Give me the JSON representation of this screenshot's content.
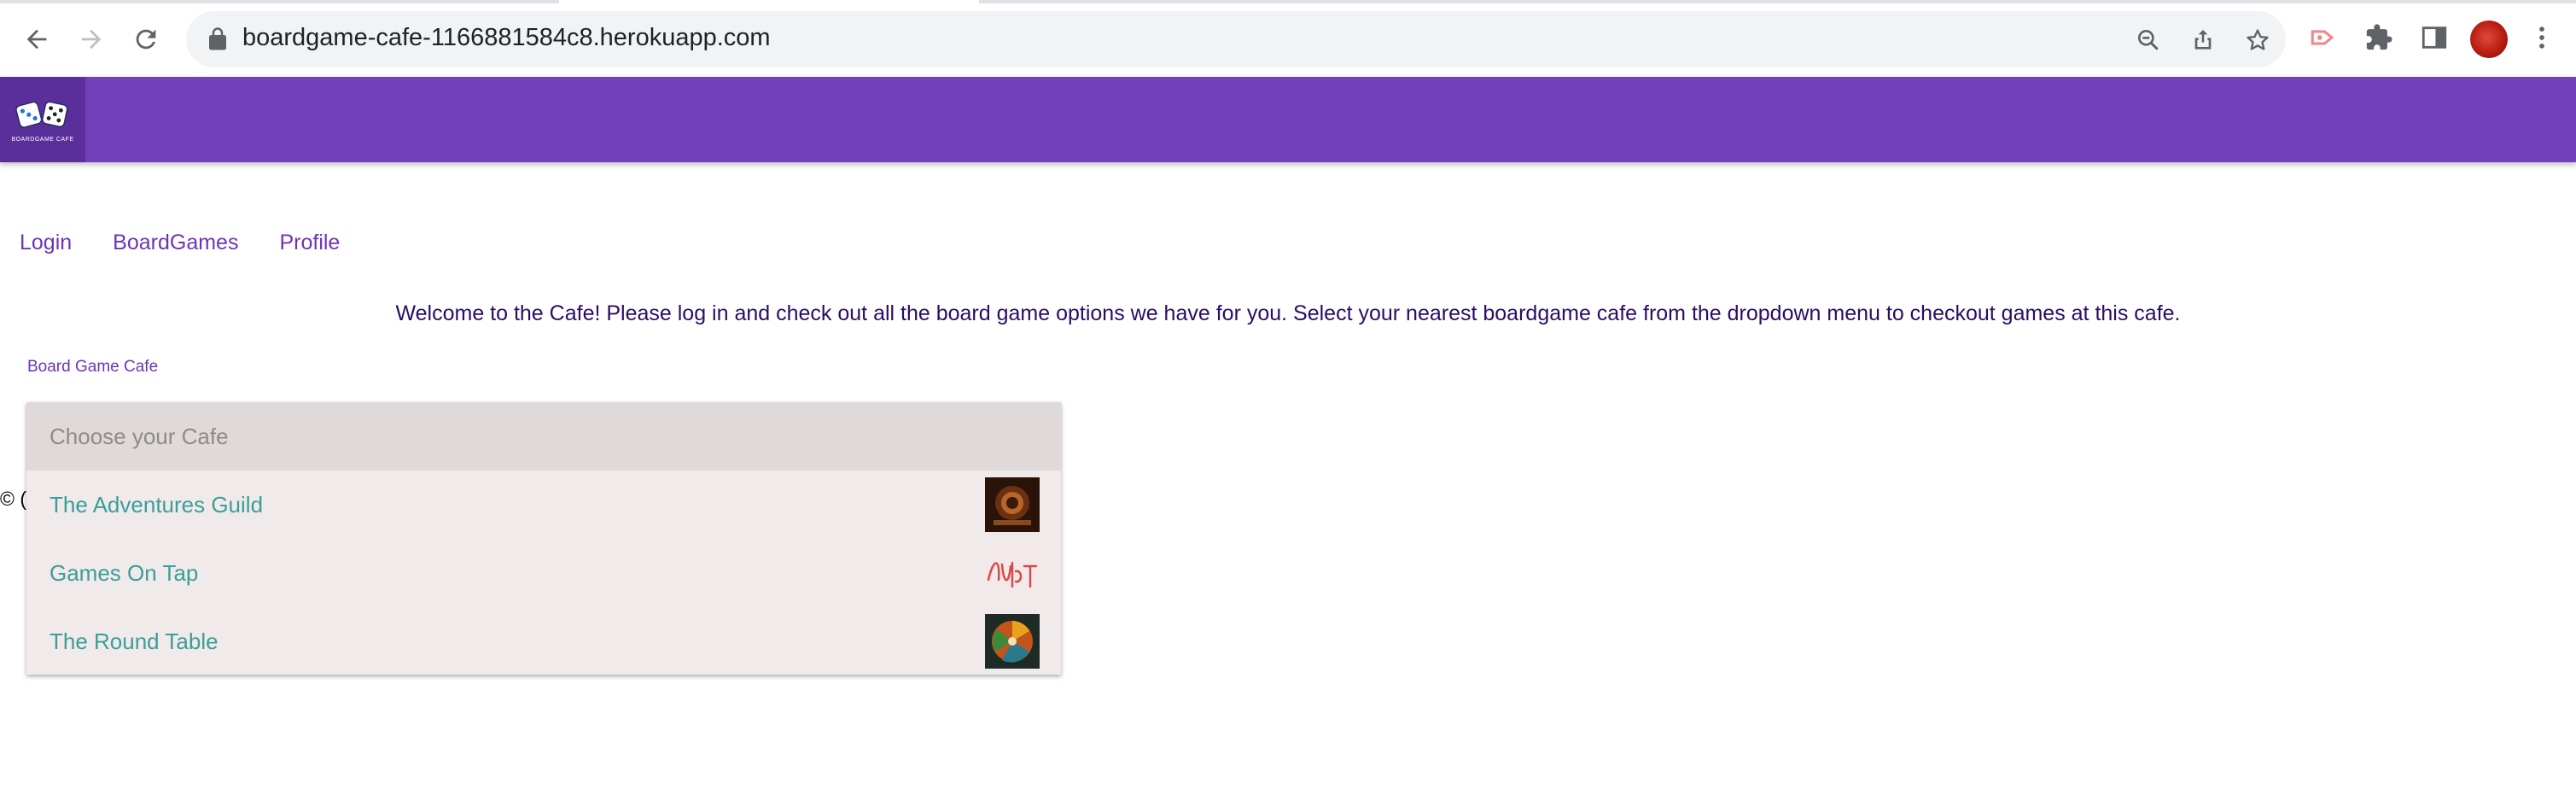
{
  "browser": {
    "url": "boardgame-cafe-1166881584c8.herokuapp.com"
  },
  "app": {
    "logo_text": "BOARDGAME CAFE",
    "brand_color": "#7340bc"
  },
  "nav": {
    "links": [
      "Login",
      "BoardGames",
      "Profile"
    ]
  },
  "main": {
    "welcome": "Welcome to the Cafe! Please log in and check out all the board game options we have for you. Select your nearest boardgame cafe from the dropdown menu to checkout games at this cafe.",
    "cafe_label": "Board Game Cafe",
    "copyright_fragment": "© (",
    "dropdown": {
      "placeholder": "Choose your Cafe",
      "options": [
        {
          "label": "The Adventures Guild",
          "icon": "adventures-guild-thumbnail"
        },
        {
          "label": "Games On Tap",
          "icon": "games-on-tap-thumbnail"
        },
        {
          "label": "The Round Table",
          "icon": "round-table-thumbnail"
        }
      ]
    }
  }
}
